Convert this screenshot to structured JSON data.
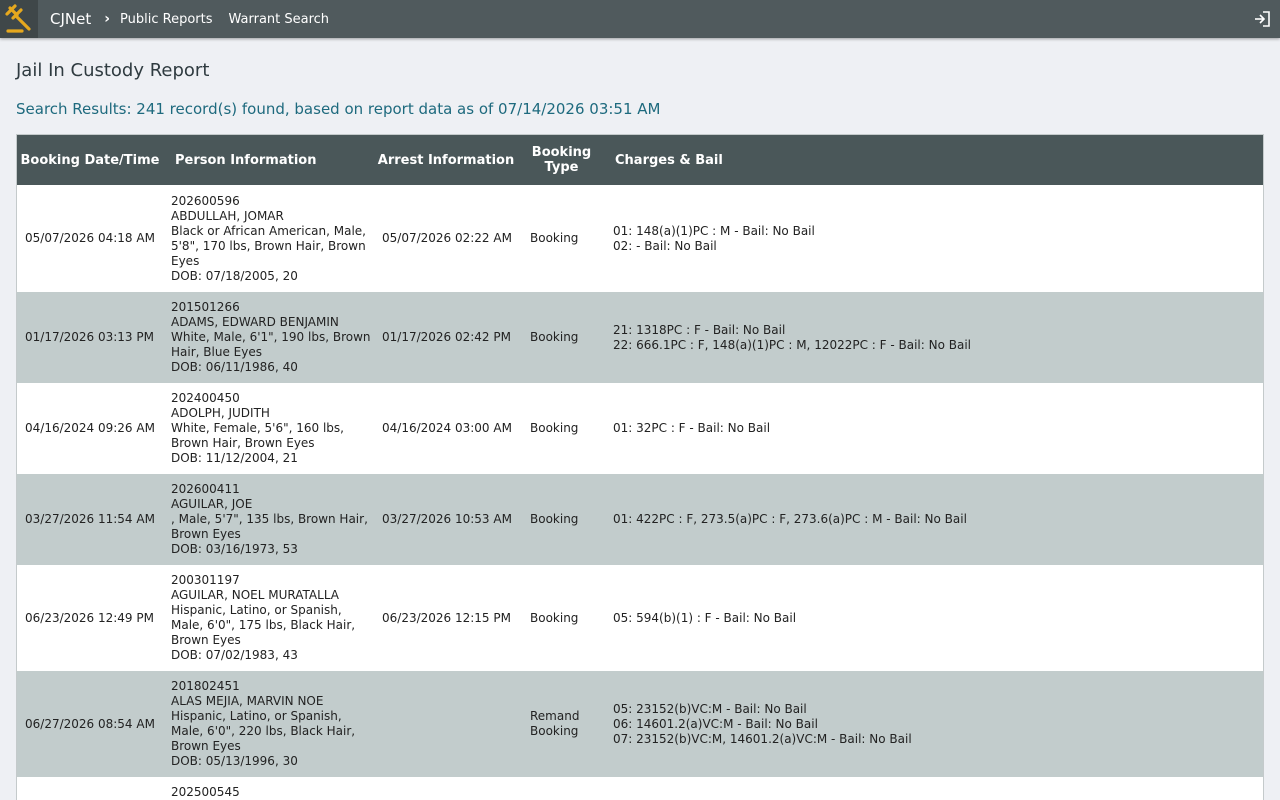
{
  "nav": {
    "brand": "CJNet",
    "separator": "›",
    "links": [
      "Public Reports",
      "Warrant Search"
    ]
  },
  "page": {
    "title": "Jail In Custody Report",
    "summary": "Search Results: 241 record(s) found, based on report data as of 07/14/2026 03:51 AM"
  },
  "table": {
    "columns": [
      "Booking Date/Time",
      "Person Information",
      "Arrest Information",
      "Booking Type",
      "Charges & Bail"
    ],
    "rows": [
      {
        "booking": "05/07/2026 04:18 AM",
        "person": [
          "202600596",
          "ABDULLAH, JOMAR",
          "Black or African American, Male, 5'8\", 170 lbs, Brown Hair, Brown Eyes",
          "DOB: 07/18/2005, 20"
        ],
        "arrest": "05/07/2026 02:22 AM",
        "type": "Booking",
        "charges": [
          "01: 148(a)(1)PC : M - Bail: No Bail",
          "02: - Bail: No Bail"
        ]
      },
      {
        "booking": "01/17/2026 03:13 PM",
        "person": [
          "201501266",
          "ADAMS, EDWARD BENJAMIN",
          "White, Male, 6'1\", 190 lbs, Brown Hair, Blue Eyes",
          "DOB: 06/11/1986, 40"
        ],
        "arrest": "01/17/2026 02:42 PM",
        "type": "Booking",
        "charges": [
          "21: 1318PC : F - Bail: No Bail",
          "22: 666.1PC : F, 148(a)(1)PC : M, 12022PC : F - Bail: No Bail"
        ]
      },
      {
        "booking": "04/16/2024 09:26 AM",
        "person": [
          "202400450",
          "ADOLPH, JUDITH",
          "White, Female, 5'6\", 160 lbs, Brown Hair, Brown Eyes",
          "DOB: 11/12/2004, 21"
        ],
        "arrest": "04/16/2024 03:00 AM",
        "type": "Booking",
        "charges": [
          "01: 32PC : F - Bail: No Bail"
        ]
      },
      {
        "booking": "03/27/2026 11:54 AM",
        "person": [
          "202600411",
          "AGUILAR, JOE",
          ", Male, 5'7\", 135 lbs, Brown Hair, Brown Eyes",
          "DOB: 03/16/1973, 53"
        ],
        "arrest": "03/27/2026 10:53 AM",
        "type": "Booking",
        "charges": [
          "01: 422PC : F, 273.5(a)PC : F, 273.6(a)PC : M - Bail: No Bail"
        ]
      },
      {
        "booking": "06/23/2026 12:49 PM",
        "person": [
          "200301197",
          "AGUILAR, NOEL MURATALLA",
          "Hispanic, Latino, or Spanish, Male, 6'0\", 175 lbs, Black Hair, Brown Eyes",
          "DOB: 07/02/1983, 43"
        ],
        "arrest": "06/23/2026 12:15 PM",
        "type": "Booking",
        "charges": [
          "05: 594(b)(1) : F - Bail: No Bail"
        ]
      },
      {
        "booking": "06/27/2026 08:54 AM",
        "person": [
          "201802451",
          "ALAS MEJIA, MARVIN NOE",
          "Hispanic, Latino, or Spanish, Male, 6'0\", 220 lbs, Black Hair, Brown Eyes",
          "DOB: 05/13/1996, 30"
        ],
        "arrest": "",
        "type": "Remand Booking",
        "charges": [
          "05: 23152(b)VC:M - Bail: No Bail",
          "06: 14601.2(a)VC:M - Bail: No Bail",
          "07: 23152(b)VC:M, 14601.2(a)VC:M - Bail: No Bail"
        ]
      },
      {
        "booking": "",
        "person": [
          "202500545"
        ],
        "arrest": "",
        "type": "",
        "charges": []
      }
    ]
  }
}
